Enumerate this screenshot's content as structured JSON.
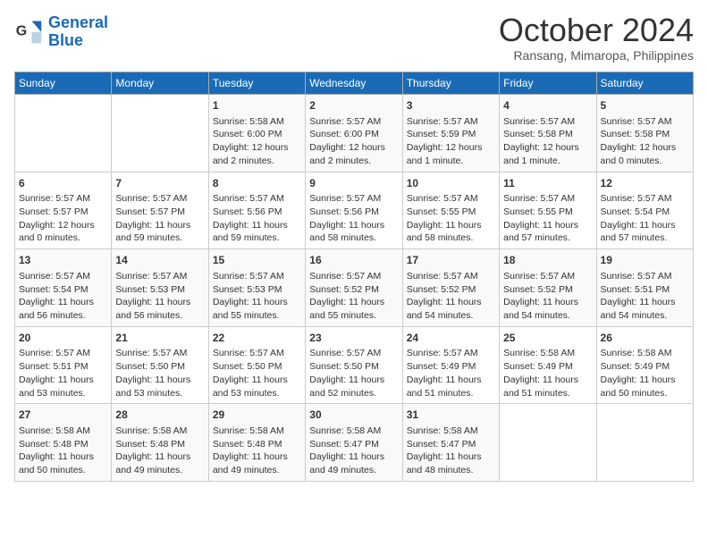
{
  "header": {
    "logo_line1": "General",
    "logo_line2": "Blue",
    "month": "October 2024",
    "location": "Ransang, Mimaropa, Philippines"
  },
  "days_of_week": [
    "Sunday",
    "Monday",
    "Tuesday",
    "Wednesday",
    "Thursday",
    "Friday",
    "Saturday"
  ],
  "weeks": [
    [
      {
        "day": "",
        "info": ""
      },
      {
        "day": "",
        "info": ""
      },
      {
        "day": "1",
        "info": "Sunrise: 5:58 AM\nSunset: 6:00 PM\nDaylight: 12 hours and 2 minutes."
      },
      {
        "day": "2",
        "info": "Sunrise: 5:57 AM\nSunset: 6:00 PM\nDaylight: 12 hours and 2 minutes."
      },
      {
        "day": "3",
        "info": "Sunrise: 5:57 AM\nSunset: 5:59 PM\nDaylight: 12 hours and 1 minute."
      },
      {
        "day": "4",
        "info": "Sunrise: 5:57 AM\nSunset: 5:58 PM\nDaylight: 12 hours and 1 minute."
      },
      {
        "day": "5",
        "info": "Sunrise: 5:57 AM\nSunset: 5:58 PM\nDaylight: 12 hours and 0 minutes."
      }
    ],
    [
      {
        "day": "6",
        "info": "Sunrise: 5:57 AM\nSunset: 5:57 PM\nDaylight: 12 hours and 0 minutes."
      },
      {
        "day": "7",
        "info": "Sunrise: 5:57 AM\nSunset: 5:57 PM\nDaylight: 11 hours and 59 minutes."
      },
      {
        "day": "8",
        "info": "Sunrise: 5:57 AM\nSunset: 5:56 PM\nDaylight: 11 hours and 59 minutes."
      },
      {
        "day": "9",
        "info": "Sunrise: 5:57 AM\nSunset: 5:56 PM\nDaylight: 11 hours and 58 minutes."
      },
      {
        "day": "10",
        "info": "Sunrise: 5:57 AM\nSunset: 5:55 PM\nDaylight: 11 hours and 58 minutes."
      },
      {
        "day": "11",
        "info": "Sunrise: 5:57 AM\nSunset: 5:55 PM\nDaylight: 11 hours and 57 minutes."
      },
      {
        "day": "12",
        "info": "Sunrise: 5:57 AM\nSunset: 5:54 PM\nDaylight: 11 hours and 57 minutes."
      }
    ],
    [
      {
        "day": "13",
        "info": "Sunrise: 5:57 AM\nSunset: 5:54 PM\nDaylight: 11 hours and 56 minutes."
      },
      {
        "day": "14",
        "info": "Sunrise: 5:57 AM\nSunset: 5:53 PM\nDaylight: 11 hours and 56 minutes."
      },
      {
        "day": "15",
        "info": "Sunrise: 5:57 AM\nSunset: 5:53 PM\nDaylight: 11 hours and 55 minutes."
      },
      {
        "day": "16",
        "info": "Sunrise: 5:57 AM\nSunset: 5:52 PM\nDaylight: 11 hours and 55 minutes."
      },
      {
        "day": "17",
        "info": "Sunrise: 5:57 AM\nSunset: 5:52 PM\nDaylight: 11 hours and 54 minutes."
      },
      {
        "day": "18",
        "info": "Sunrise: 5:57 AM\nSunset: 5:52 PM\nDaylight: 11 hours and 54 minutes."
      },
      {
        "day": "19",
        "info": "Sunrise: 5:57 AM\nSunset: 5:51 PM\nDaylight: 11 hours and 54 minutes."
      }
    ],
    [
      {
        "day": "20",
        "info": "Sunrise: 5:57 AM\nSunset: 5:51 PM\nDaylight: 11 hours and 53 minutes."
      },
      {
        "day": "21",
        "info": "Sunrise: 5:57 AM\nSunset: 5:50 PM\nDaylight: 11 hours and 53 minutes."
      },
      {
        "day": "22",
        "info": "Sunrise: 5:57 AM\nSunset: 5:50 PM\nDaylight: 11 hours and 53 minutes."
      },
      {
        "day": "23",
        "info": "Sunrise: 5:57 AM\nSunset: 5:50 PM\nDaylight: 11 hours and 52 minutes."
      },
      {
        "day": "24",
        "info": "Sunrise: 5:57 AM\nSunset: 5:49 PM\nDaylight: 11 hours and 51 minutes."
      },
      {
        "day": "25",
        "info": "Sunrise: 5:58 AM\nSunset: 5:49 PM\nDaylight: 11 hours and 51 minutes."
      },
      {
        "day": "26",
        "info": "Sunrise: 5:58 AM\nSunset: 5:49 PM\nDaylight: 11 hours and 50 minutes."
      }
    ],
    [
      {
        "day": "27",
        "info": "Sunrise: 5:58 AM\nSunset: 5:48 PM\nDaylight: 11 hours and 50 minutes."
      },
      {
        "day": "28",
        "info": "Sunrise: 5:58 AM\nSunset: 5:48 PM\nDaylight: 11 hours and 49 minutes."
      },
      {
        "day": "29",
        "info": "Sunrise: 5:58 AM\nSunset: 5:48 PM\nDaylight: 11 hours and 49 minutes."
      },
      {
        "day": "30",
        "info": "Sunrise: 5:58 AM\nSunset: 5:47 PM\nDaylight: 11 hours and 49 minutes."
      },
      {
        "day": "31",
        "info": "Sunrise: 5:58 AM\nSunset: 5:47 PM\nDaylight: 11 hours and 48 minutes."
      },
      {
        "day": "",
        "info": ""
      },
      {
        "day": "",
        "info": ""
      }
    ]
  ]
}
